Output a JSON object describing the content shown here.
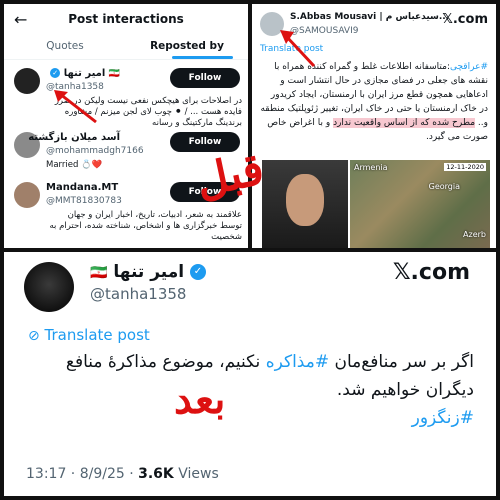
{
  "left_panel": {
    "title": "Post interactions",
    "tabs": [
      "Quotes",
      "Reposted by"
    ],
    "users": [
      {
        "name": "امیر تنها",
        "handle": "@tanha1358",
        "bio": "در اصلاحات برای هیچکس نفعی نیست ولیکن در ضرر فایده هست ... / ⚫ چوب لای لجن میزنم / مشاوره برندینگ مارکتینگ و رسانه",
        "follow": "Follow"
      },
      {
        "name": "آسد میلان بازگشته",
        "handle": "@mohammadgh7166",
        "bio": "Married 💍❤️",
        "follow": "Follow"
      },
      {
        "name": "Mandana.MT",
        "handle": "@MMT81830783",
        "bio": "علاقمند به شعر، ادبیات، تاریخ، اخبار ایران و جهان توسط خبرگزاری ها و اشخاص، شناخته شده، احترام به شخصیت",
        "follow": "Follow"
      }
    ]
  },
  "right_panel": {
    "name": "S.Abbas Mousavi | سیدعباس م...",
    "handle": "@SAMOUSAVI9",
    "logo": "𝕏.com",
    "translate": "Translate post",
    "body_hashtag": "#عراقچی",
    "body_text": ":متاسفانه اطلاعات غلط و گمراه کننده همراه با نقشه های جعلی در فضای مجازی در حال انتشار است و ادعاهایی همچون قطع مرز ایران با ارمنستان، ایجاد کریدور در خاک ارمنستان یا حتی در خاک ایران، تغییر ژئوپلتیک منطقه و..",
    "highlight": "مطرح شده که از اساس واقعیت ندارد",
    "body_tail": "و با اغراض خاص صورت می گیرد.",
    "map_labels": [
      "Armenia",
      "Georgia",
      "Azerb"
    ],
    "map_date": "12-11-2020"
  },
  "bottom_panel": {
    "name": "امیر تنها",
    "handle": "@tanha1358",
    "logo": "𝕏.com",
    "translate": "Translate post",
    "body_part1": "اگر بر سر منافع‌مان",
    "body_hashtag": "#مذاکره",
    "body_part2": "نکنیم، موضوع مذاکرهٔ منافع دیگران خواهیم شد.",
    "hashtag2": "#زنگزور",
    "time": "13:17 · 8/9/25 · ",
    "views_count": "3.6K",
    "views_label": "Views"
  },
  "annotations": {
    "before": "قبل",
    "after": "بعد"
  },
  "colors": {
    "accent": "#1d9bf0",
    "annotation": "#dd1111"
  }
}
